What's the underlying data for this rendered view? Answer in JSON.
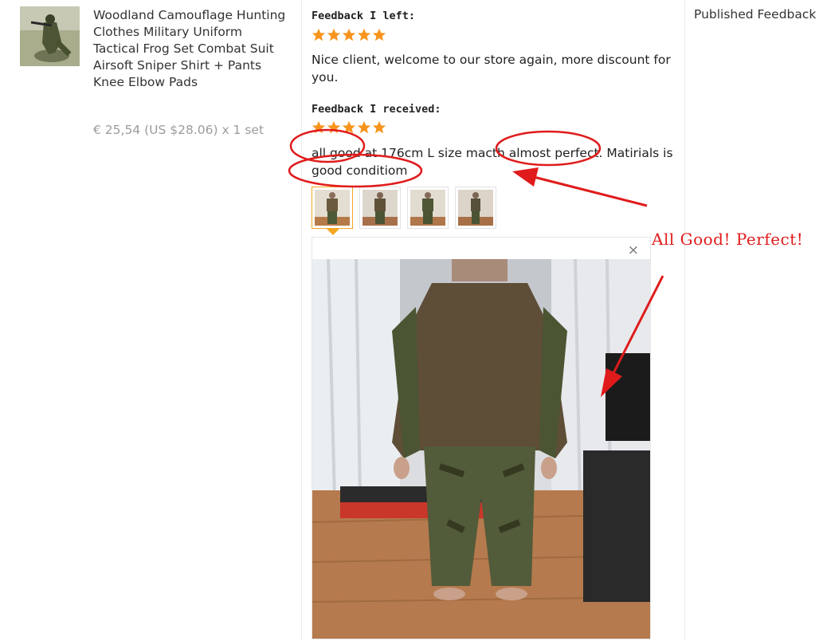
{
  "product": {
    "title": "Woodland Camouflage Hunting Clothes Military Uniform Tactical Frog Set Combat Suit Airsoft Sniper Shirt + Pants Knee Elbow Pads",
    "price": "€ 25,54 (US $28.06) x 1 set",
    "thumbnail_icon": "product-photo"
  },
  "feedback_left": {
    "heading": "Feedback I left:",
    "rating": 5,
    "text": "Nice client, welcome to our store again, more discount for you."
  },
  "feedback_received": {
    "heading": "Feedback I received:",
    "rating": 5,
    "text": "all good at 176cm L size macth almost perfect. Matirials is good conditiom"
  },
  "photos": {
    "count": 4,
    "selected_index": 0,
    "close_label": "×"
  },
  "published_feedback": "Published Feedback",
  "annotation": {
    "text": "All Good! Perfect!",
    "color": "#e01b1b"
  },
  "colors": {
    "star": "#f7941d",
    "selected_border": "#f5a623",
    "price": "#9b9b9b"
  }
}
